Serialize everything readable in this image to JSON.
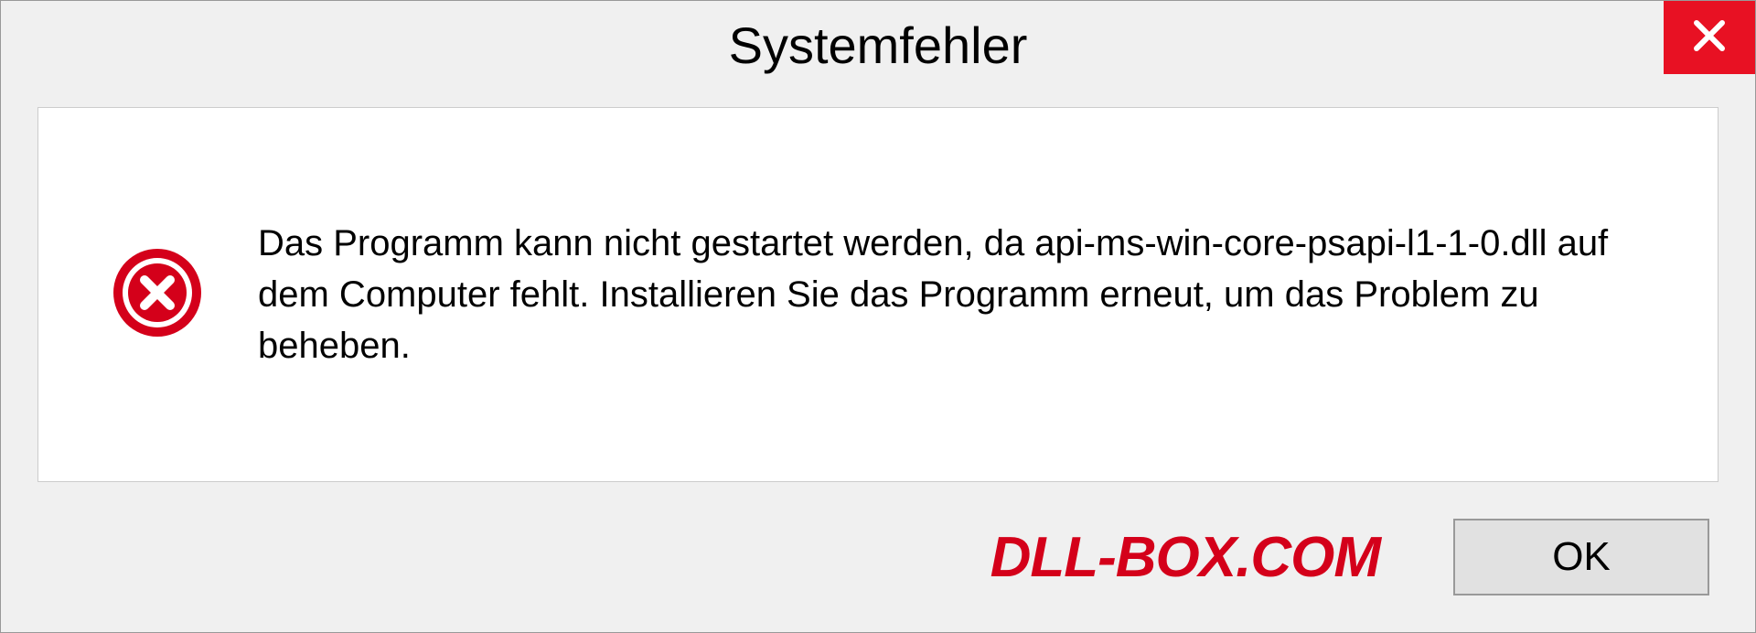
{
  "dialog": {
    "title": "Systemfehler",
    "message": "Das Programm kann nicht gestartet werden, da api-ms-win-core-psapi-l1-1-0.dll auf dem Computer fehlt. Installieren Sie das Programm erneut, um das Problem zu beheben.",
    "ok_label": "OK"
  },
  "watermark": "DLL-BOX.COM",
  "colors": {
    "close_bg": "#e81123",
    "error_icon": "#d4001a",
    "watermark": "#d4001a"
  }
}
